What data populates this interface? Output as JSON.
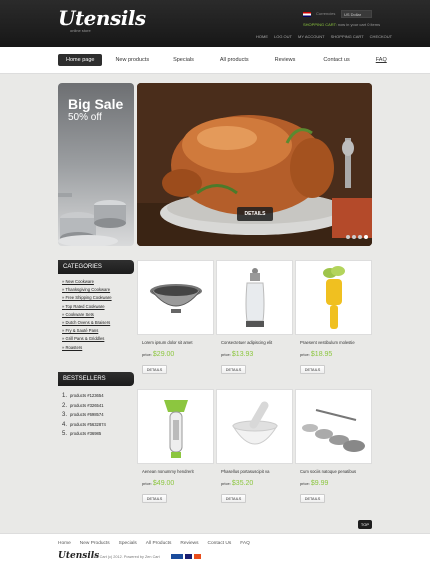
{
  "header": {
    "logo": "Utensils",
    "tagline": "online store",
    "currencies_label": "Currencies",
    "currency_value": "US Dollar",
    "cart_label": "SHOPPING CART:",
    "cart_text": "now in your cart 0 items",
    "links": [
      "HOME",
      "LOG OUT",
      "MY ACCOUNT",
      "SHOPPING CART",
      "CHECKOUT"
    ]
  },
  "nav": {
    "items": [
      "Home page",
      "New products",
      "Specials",
      "All products",
      "Reviews",
      "Contact us",
      "FAQ"
    ]
  },
  "banner": {
    "title": "Big Sale",
    "subtitle": "50% off",
    "button": "DETAILS"
  },
  "sidebar": {
    "categories_title": "CATEGORIES",
    "categories": [
      "New Cookware",
      "Thanksgiving Cookware",
      "Free Shipping Cookware",
      "Top Rated Cookware",
      "Cookware Sets",
      "Dutch Ovens & Braisers",
      "Fry & Sauté Pans",
      "Grill Pans & Griddles",
      "Roasters"
    ],
    "bestsellers_title": "BESTSELLERS",
    "bestsellers": [
      {
        "n": "1.",
        "label": "products #123654"
      },
      {
        "n": "2.",
        "label": "products #326541"
      },
      {
        "n": "3.",
        "label": "products #698574"
      },
      {
        "n": "4.",
        "label": "products #5632874"
      },
      {
        "n": "5.",
        "label": "products #36985"
      }
    ]
  },
  "products": [
    {
      "name": "Lorem ipsum dolor sit amet",
      "price_label": "price:",
      "price": "$29.00",
      "button": "DETAILS"
    },
    {
      "name": "Consectetuer adipiscing elit",
      "price_label": "price:",
      "price": "$13.93",
      "button": "DETAILS"
    },
    {
      "name": "Praesent vestibulum molestie",
      "price_label": "price:",
      "price": "$18.95",
      "button": "DETAILS"
    },
    {
      "name": "Aenean nonummy hendrerit",
      "price_label": "price:",
      "price": "$49.00",
      "button": "DETAILS"
    },
    {
      "name": "Phasellus portasuscipit va",
      "price_label": "price:",
      "price": "$35.20",
      "button": "DETAILS"
    },
    {
      "name": "Cum sociis natoque penatibus",
      "price_label": "price:",
      "price": "$9.99",
      "button": "DETAILS"
    }
  ],
  "top_button": "TOP",
  "footer": {
    "links": [
      "Home",
      "New Products",
      "Specials",
      "All Products",
      "Reviews",
      "Contact Us",
      "FAQ"
    ],
    "logo": "Utensils",
    "copyright": "Zen Cart (c) 2012. Powered by Zen Cart"
  },
  "colors": {
    "accent": "#8cc63f",
    "header_bg": "#1d1d1d",
    "nav_active": "#2e2e2e"
  }
}
